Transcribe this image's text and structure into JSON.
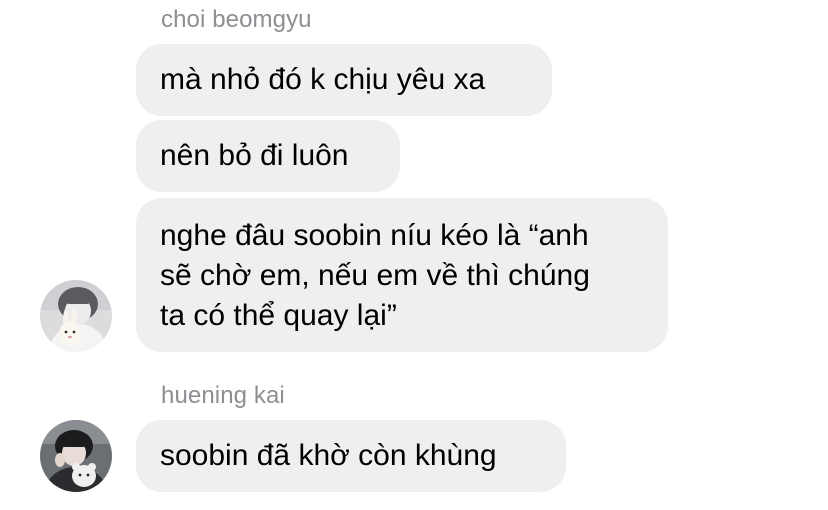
{
  "conversation": {
    "groups": [
      {
        "sender": "choi beomgyu",
        "messages": [
          "mà nhỏ đó k chịu yêu xa",
          "nên bỏ đi luôn",
          "nghe đâu soobin níu kéo là “anh sẽ chờ em, nếu em về thì chúng ta có thể quay lại”"
        ],
        "message_lines": [
          "nghe đâu soobin níu kéo là “anh",
          "sẽ chờ em, nếu em về thì chúng",
          "ta có thể quay lại”"
        ],
        "avatar_icon": "person-with-bunny-plush-avatar"
      },
      {
        "sender": "huening kai",
        "messages": [
          "soobin đã khờ còn khùng"
        ],
        "avatar_icon": "person-with-plush-toy-avatar"
      }
    ]
  },
  "colors": {
    "background": "#ffffff",
    "bubble": "#efefef",
    "sender_name": "#8e8e93",
    "text": "#000000"
  }
}
